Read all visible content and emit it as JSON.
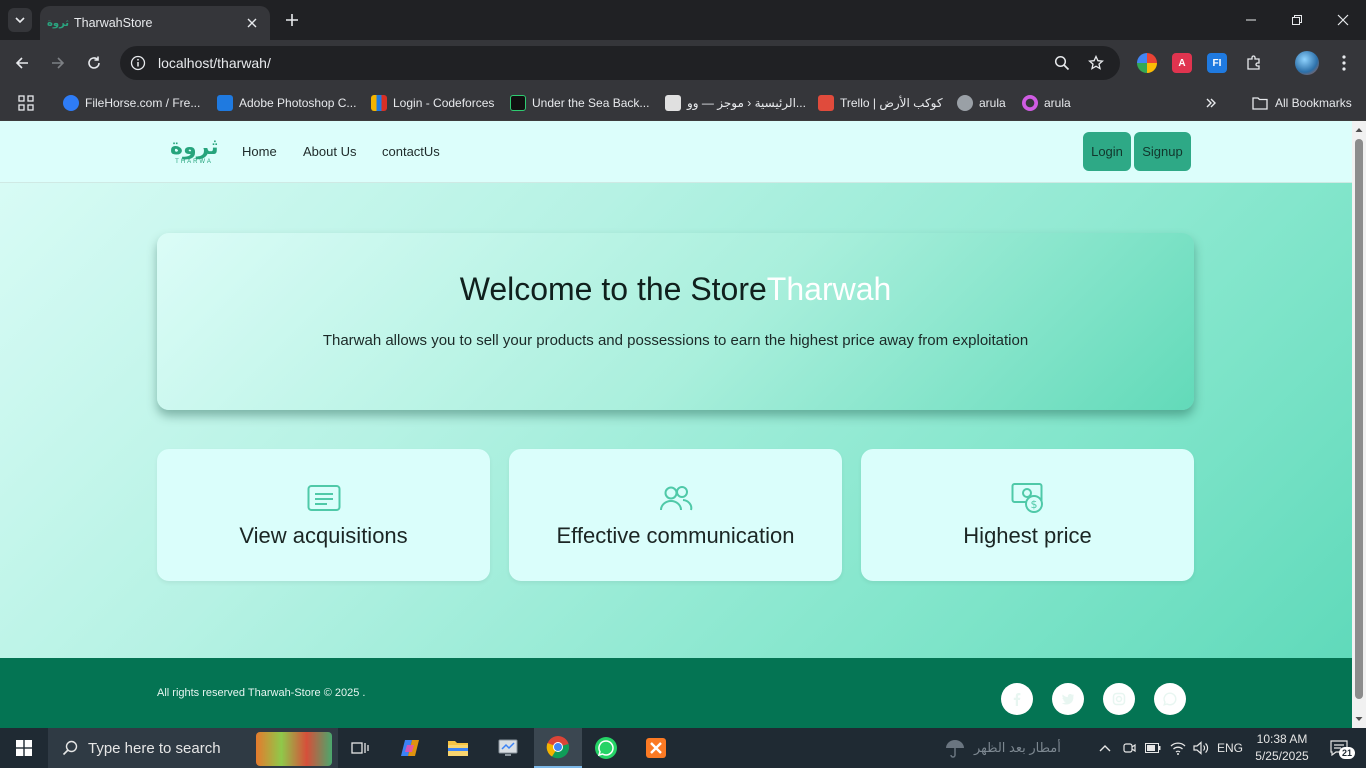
{
  "browser": {
    "tab": {
      "title": "TharwahStore",
      "favicon_text": "ثروة"
    },
    "url": "localhost/tharwah/",
    "bookmarks": [
      {
        "label": "FileHorse.com / Fre...",
        "color": "#2e7cf6"
      },
      {
        "label": "Adobe Photoshop C...",
        "color": "#1f7ae0"
      },
      {
        "label": "Login - Codeforces",
        "color": "#f4b400"
      },
      {
        "label": "Under the Sea Back...",
        "color": "#111111"
      },
      {
        "label": "الرئيسية ‹ موجز — وو...",
        "color": "#e0e0e0"
      },
      {
        "label": "Trello | كوكب الأرض",
        "color": "#e04b3c"
      },
      {
        "label": "arula",
        "color": "#9aa0a6"
      },
      {
        "label": "arula",
        "color": "#d05ce3"
      }
    ],
    "all_bookmarks": "All Bookmarks",
    "extensions": [
      {
        "name": "color-ext",
        "color": "#f4b400"
      },
      {
        "name": "pdf-ext",
        "color": "#e0344f",
        "text": "A"
      },
      {
        "name": "fi-ext",
        "color": "#1f7ae0",
        "text": "FI"
      }
    ]
  },
  "site": {
    "logo": {
      "arabic": "ثروة",
      "latin": "THARWA"
    },
    "nav": [
      "Home",
      "About Us",
      "contactUs"
    ],
    "login": "Login",
    "signup": "Signup",
    "hero": {
      "title": "Welcome to the Store",
      "brand": "Tharwah",
      "subtitle": "Tharwah allows you to sell your products and possessions to earn the highest price away from exploitation"
    },
    "cards": [
      {
        "icon": "list-icon",
        "title": "View acquisitions"
      },
      {
        "icon": "people-icon",
        "title": "Effective communication"
      },
      {
        "icon": "money-icon",
        "title": "Highest price"
      }
    ],
    "footer": {
      "copyright": "All rights reserved Tharwah-Store © 2025 .",
      "social": [
        "facebook-icon",
        "twitter-icon",
        "instagram-icon",
        "whatsapp-icon"
      ]
    },
    "accent": "#2ea986",
    "footer_color": "#047453"
  },
  "taskbar": {
    "search_placeholder": "Type here to search",
    "weather": "أمطار بعد الظهر",
    "language": "ENG",
    "time": "10:38 AM",
    "date": "5/25/2025",
    "notifications": "21"
  }
}
